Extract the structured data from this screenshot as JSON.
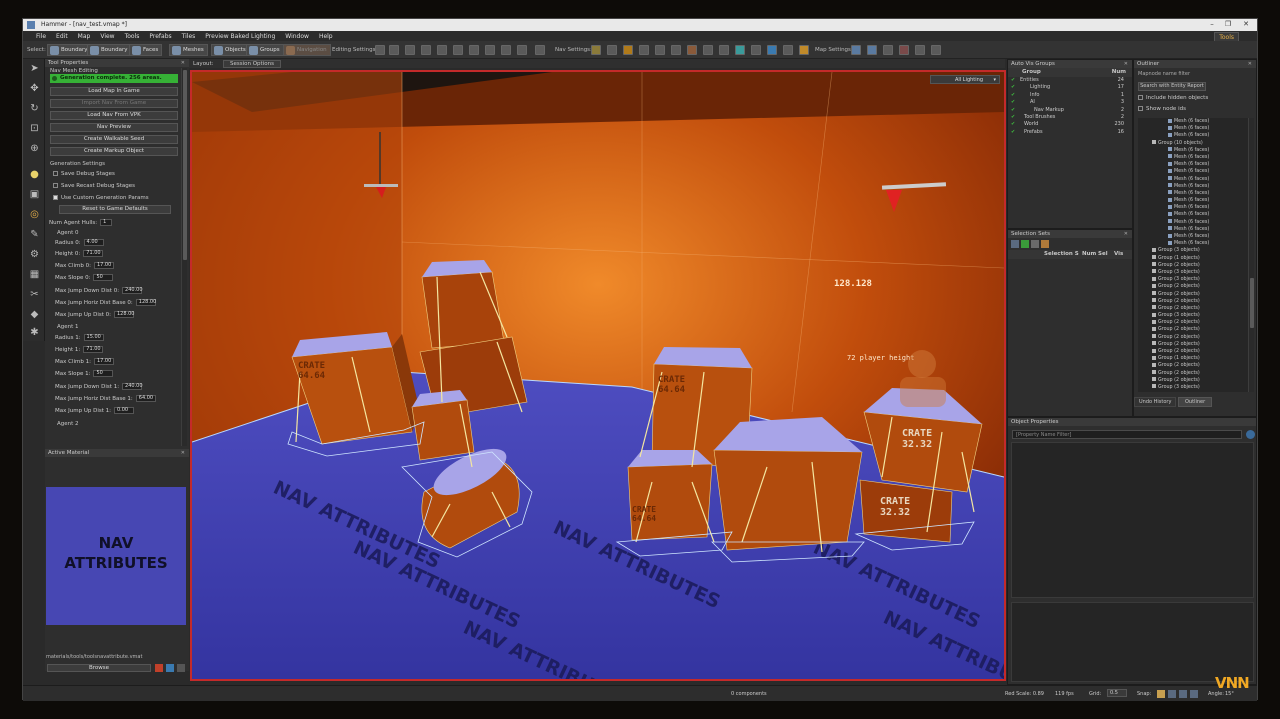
{
  "window": {
    "title": "Hammer - [nav_test.vmap *]",
    "controls": [
      "–",
      "❐",
      "✕"
    ]
  },
  "menu": [
    "File",
    "Edit",
    "Map",
    "View",
    "Tools",
    "Prefabs",
    "Tiles",
    "Preview Baked Lighting",
    "Window",
    "Help"
  ],
  "tools_button": "Tools",
  "toolbar": {
    "select_label": "Select:",
    "modes": [
      "Boundary",
      "Boundary",
      "Faces",
      "Meshes",
      "Objects",
      "Groups",
      "Navigation"
    ],
    "editing_settings": "Editing Settings:",
    "nav_settings": "Nav Settings:",
    "map_settings": "Map Settings:"
  },
  "tool_properties": {
    "header": "Tool Properties",
    "section": "Nav Mesh Editing",
    "status": "Generation complete. 256 areas.",
    "buttons": [
      "Load Map In Game",
      "Import Nav From Game",
      "Load Nav From VPK",
      "Nav Preview",
      "Create Walkable Seed",
      "Create Markup Object"
    ],
    "generation_settings": "Generation Settings",
    "checks": [
      {
        "label": "Save Debug Stages",
        "on": false
      },
      {
        "label": "Save Recast Debug Stages",
        "on": false
      },
      {
        "label": "Use Custom Generation Params",
        "on": true
      }
    ],
    "reset_button": "Reset to Game Defaults",
    "num_agent_hulls_label": "Num Agent Hulls:",
    "num_agent_hulls": "1",
    "agent0": {
      "title": "Agent 0",
      "fields": [
        {
          "label": "Radius 0:",
          "value": "4.00"
        },
        {
          "label": "Height 0:",
          "value": "71.00"
        },
        {
          "label": "Max Climb 0:",
          "value": "17.00"
        },
        {
          "label": "Max Slope 0:",
          "value": "50"
        },
        {
          "label": "Max Jump Down Dist 0:",
          "value": "240.00"
        },
        {
          "label": "Max Jump Horiz Dist Base 0:",
          "value": "128.00"
        },
        {
          "label": "Max Jump Up Dist 0:",
          "value": "128.00"
        }
      ]
    },
    "agent1": {
      "title": "Agent 1",
      "fields": [
        {
          "label": "Radius 1:",
          "value": "15.00"
        },
        {
          "label": "Height 1:",
          "value": "71.00"
        },
        {
          "label": "Max Climb 1:",
          "value": "17.00"
        },
        {
          "label": "Max Slope 1:",
          "value": "50"
        },
        {
          "label": "Max Jump Down Dist 1:",
          "value": "240.00"
        },
        {
          "label": "Max Jump Horiz Dist Base 1:",
          "value": "64.00"
        },
        {
          "label": "Max Jump Up Dist 1:",
          "value": "0.00"
        }
      ]
    },
    "agent2_title": "Agent 2"
  },
  "active_material": {
    "header": "Active Material",
    "tile_text": "NAV\nATTRIBUTES",
    "path": "materials/tools/toolsnavattribute.vmat",
    "browse": "Browse"
  },
  "viewport": {
    "layout_label": "Layout:",
    "session_options": "Session Options",
    "lighting": "All Lighting",
    "crate_labels": [
      "CRATE\n64.64",
      "CRATE\n64.64",
      "CRATE\n32.32",
      "CRATE\n32.32",
      "CRATE\n64.64"
    ],
    "wall_labels": [
      "128.128",
      "72 player height"
    ],
    "floor_text": "NAV ATTRIBUTES",
    "floor_text2": "NAV ATTRIBUTES"
  },
  "auto_vis_groups": {
    "header": "Auto Vis Groups",
    "col_group": "Group",
    "col_num": "Num",
    "rows": [
      {
        "name": "Entities",
        "num": "24",
        "indent": 0
      },
      {
        "name": "Lighting",
        "num": "17",
        "indent": 1
      },
      {
        "name": "Info",
        "num": "1",
        "indent": 1
      },
      {
        "name": "AI",
        "num": "3",
        "indent": 1
      },
      {
        "name": "Nav Markup",
        "num": "2",
        "indent": 2
      },
      {
        "name": "Tool Brushes",
        "num": "2",
        "indent": 0
      },
      {
        "name": "World",
        "num": "230",
        "indent": 0
      },
      {
        "name": "Prefabs",
        "num": "16",
        "indent": 0
      }
    ]
  },
  "selection_sets": {
    "header": "Selection Sets",
    "columns": [
      "Selection S",
      "Num",
      "Sel",
      "Vis"
    ]
  },
  "outliner": {
    "header": "Outliner",
    "filter_placeholder": "Mapnode name filter",
    "search_button": "Search with Entity Report",
    "checks": [
      "Include hidden objects",
      "Show node ids"
    ],
    "items": [
      "Mesh (6 faces)",
      "Mesh (6 faces)",
      "Mesh (6 faces)",
      "Group (10 objects)",
      "Mesh (6 faces)",
      "Mesh (6 faces)",
      "Mesh (6 faces)",
      "Mesh (6 faces)",
      "Mesh (6 faces)",
      "Mesh (6 faces)",
      "Mesh (6 faces)",
      "Mesh (6 faces)",
      "Mesh (6 faces)",
      "Mesh (6 faces)",
      "Mesh (6 faces)",
      "Mesh (6 faces)",
      "Mesh (6 faces)",
      "Mesh (6 faces)",
      "Group (3 objects)",
      "Group (1 objects)",
      "Group (2 objects)",
      "Group (3 objects)",
      "Group (3 objects)",
      "Group (2 objects)",
      "Group (2 objects)",
      "Group (2 objects)",
      "Group (2 objects)",
      "Group (3 objects)",
      "Group (2 objects)",
      "Group (2 objects)",
      "Group (2 objects)",
      "Group (2 objects)",
      "Group (2 objects)",
      "Group (1 objects)",
      "Group (2 objects)",
      "Group (2 objects)",
      "Group (2 objects)",
      "Group (3 objects)"
    ],
    "tabs": [
      "Undo History",
      "Outliner"
    ]
  },
  "object_properties": {
    "header": "Object Properties",
    "filter_placeholder": "[Property Name Filter]"
  },
  "statusbar": {
    "components": "0 components",
    "red_scale": "Red Scale: 0.89",
    "fps": "119 fps",
    "grid_label": "Grid:",
    "grid_value": "0.5",
    "snap_label": "Snap:",
    "angle_label": "Angle:",
    "angle_value": "15°"
  },
  "watermark": "VNN"
}
